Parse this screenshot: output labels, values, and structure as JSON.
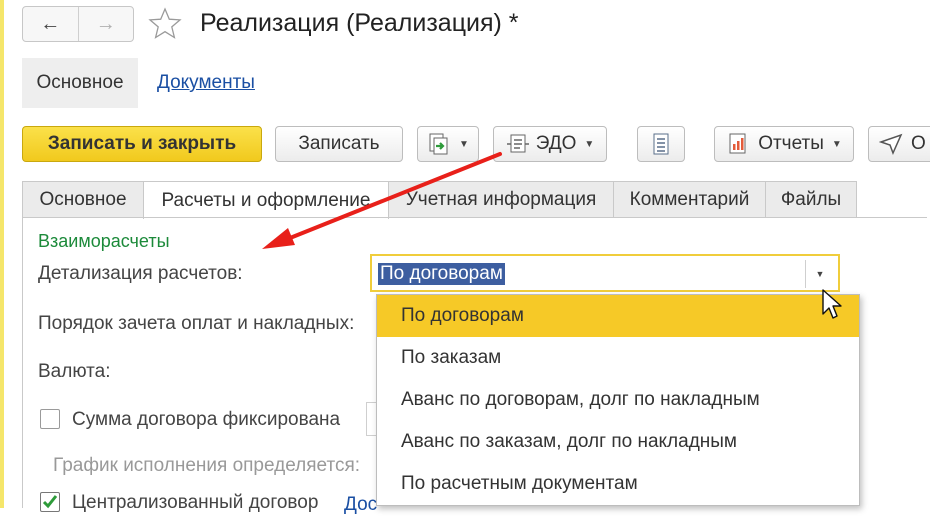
{
  "window": {
    "title": "Реализация (Реализация) *"
  },
  "sections": {
    "main": "Основное",
    "documents": "Документы"
  },
  "toolbar": {
    "save_close": "Записать и закрыть",
    "save": "Записать",
    "edo": "ЭДО",
    "reports": "Отчеты",
    "cut_btn": "О"
  },
  "tabs": [
    "Основное",
    "Расчеты и оформление",
    "Учетная информация",
    "Комментарий",
    "Файлы"
  ],
  "form": {
    "group_title": "Взаиморасчеты",
    "detail_label": "Детализация расчетов:",
    "detail_value": "По договорам",
    "offset_label": "Порядок зачета оплат и накладных:",
    "currency_label": "Валюта:",
    "fixed_sum_label": "Сумма договора фиксирована",
    "schedule_label": "График исполнения определяется:",
    "centralized_label": "Централизованный договор",
    "link_cut": "Дос"
  },
  "dropdown": {
    "options": [
      "По договорам",
      "По заказам",
      "Аванс по договорам, долг по накладным",
      "Аванс по заказам, долг по накладным",
      "По расчетным документам"
    ],
    "selected_index": 0
  },
  "colors": {
    "primary_button": "#f1c91d",
    "selected_option": "#f6c927",
    "group_title": "#1c8a3a",
    "link": "#1a4fa3",
    "annotation_arrow": "#e8201a"
  }
}
